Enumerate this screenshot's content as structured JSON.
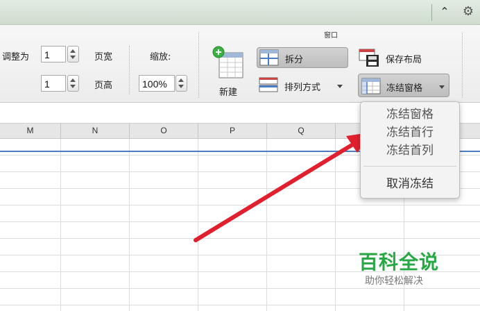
{
  "ribbon": {
    "scale": {
      "adjust_label": "调整为",
      "width_value": "1",
      "width_label": "页宽",
      "height_value": "1",
      "height_label": "页高",
      "zoom_label": "缩放:",
      "zoom_value": "100%"
    },
    "window_group": {
      "title": "窗口",
      "new_label": "新建",
      "split_label": "拆分",
      "arrange_label": "排列方式",
      "save_layout_label": "保存布局",
      "freeze_label": "冻结窗格"
    }
  },
  "columns": [
    "M",
    "N",
    "O",
    "P",
    "Q"
  ],
  "freeze_menu": {
    "items": [
      "冻结窗格",
      "冻结首行",
      "冻结首列"
    ],
    "unfreeze": "取消冻结"
  },
  "watermark": {
    "title": "百科全说",
    "subtitle": "助你轻松解决"
  },
  "colors": {
    "watermark_green": "#28a745",
    "arrow_red": "#e0202e",
    "freeze_line": "#4a7cc4"
  }
}
